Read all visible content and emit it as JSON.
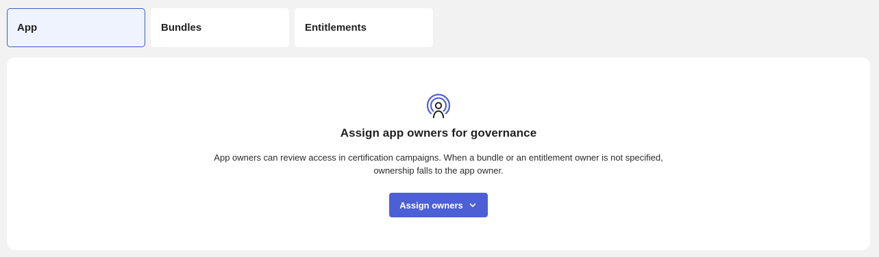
{
  "tabs": [
    {
      "label": "App",
      "active": true
    },
    {
      "label": "Bundles",
      "active": false
    },
    {
      "label": "Entitlements",
      "active": false
    }
  ],
  "empty_state": {
    "icon": "user-broadcast-icon",
    "title": "Assign app owners for governance",
    "description_line1": "App owners can review access in certification campaigns. When a bundle or an entitlement owner is not specified,",
    "description_line2": "ownership falls to the app owner.",
    "button_label": "Assign owners",
    "button_icon": "chevron-down-icon"
  },
  "colors": {
    "accent": "#4c5fd5",
    "active_tab_border": "#3b5fc0",
    "active_tab_bg": "#eef3fd",
    "page_bg": "#f2f2f2"
  }
}
